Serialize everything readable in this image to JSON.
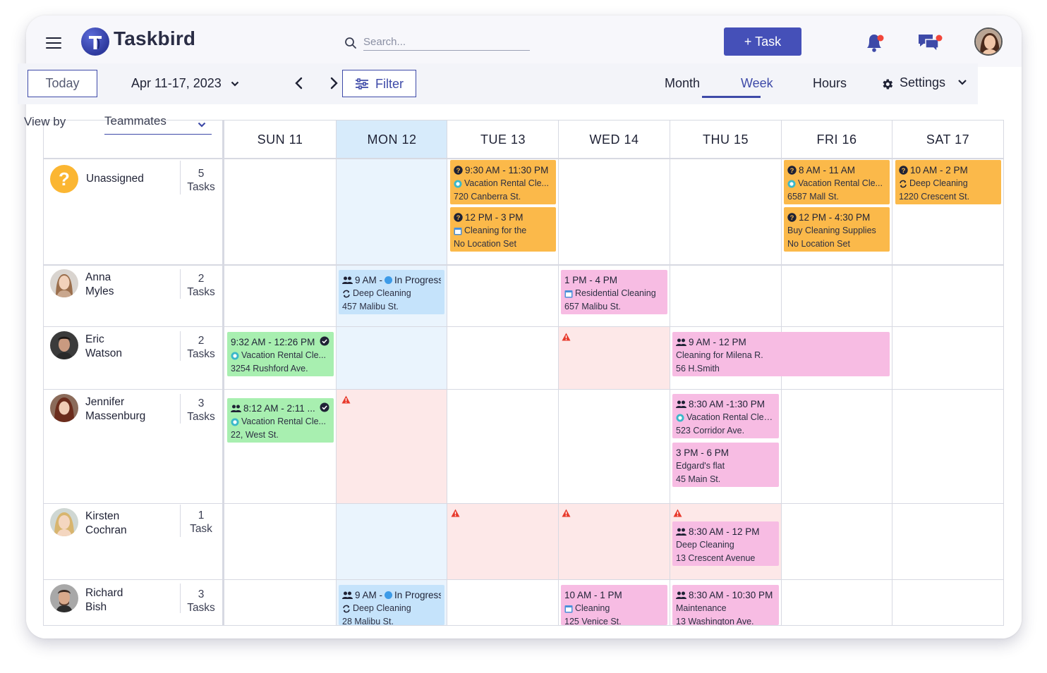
{
  "app": {
    "name": "Taskbird"
  },
  "header": {
    "search_placeholder": "Search...",
    "add_task_label": "+ Task"
  },
  "toolbar": {
    "today_label": "Today",
    "date_range": "Apr 11-17, 2023",
    "filter_label": "Filter",
    "views": [
      "Month",
      "Week",
      "Hours"
    ],
    "active_view": "Week",
    "settings_label": "Settings"
  },
  "grid": {
    "view_by_label": "View by",
    "view_by_value": "Teammates",
    "days": [
      "SUN 11",
      "MON 12",
      "TUE 13",
      "WED 14",
      "THU 15",
      "FRI 16",
      "SAT 17"
    ],
    "today_index": 1
  },
  "rows": [
    {
      "first": "Unassigned",
      "last": "",
      "count": "5",
      "count_label": "Tasks"
    },
    {
      "first": "Anna",
      "last": "Myles",
      "count": "2",
      "count_label": "Tasks"
    },
    {
      "first": "Eric",
      "last": "Watson",
      "count": "2",
      "count_label": "Tasks"
    },
    {
      "first": "Jennifer",
      "last": "Massenburg",
      "count": "3",
      "count_label": "Tasks"
    },
    {
      "first": "Kirsten",
      "last": "Cochran",
      "count": "1",
      "count_label": "Task"
    },
    {
      "first": "Richard",
      "last": "Bish",
      "count": "3",
      "count_label": "Tasks"
    }
  ],
  "tasks": {
    "t1": {
      "time": "9:30 AM - 11:30 PM",
      "title": "Vacation Rental Cle...",
      "location": "720 Canberra St."
    },
    "t2": {
      "time": "12 PM - 3 PM",
      "title": "Cleaning for the",
      "location": "No Location Set"
    },
    "t3": {
      "time": "8 AM - 11 AM",
      "title": "Vacation Rental Cle...",
      "location": "6587 Mall St."
    },
    "t4": {
      "time": "12 PM - 4:30 PM",
      "title": "Buy Cleaning Supplies",
      "location": "No Location Set"
    },
    "t5": {
      "time": "10 AM - 2 PM",
      "title": "Deep Cleaning",
      "location": "1220 Crescent St."
    },
    "t6": {
      "time": "9 AM -",
      "status": "In Progress",
      "title": "Deep Cleaning",
      "location": "457 Malibu St."
    },
    "t7": {
      "time": "1 PM - 4 PM",
      "title": "Residential Cleaning",
      "location": "657 Malibu St."
    },
    "t8": {
      "time": "9:32 AM - 12:26 PM",
      "title": "Vacation Rental Cle...",
      "location": "3254 Rushford Ave."
    },
    "t9": {
      "time": "9 AM - 12 PM",
      "title": "Cleaning for Milena R.",
      "location": "56 H.Smith"
    },
    "t10": {
      "time": "8:12 AM - 2:11 ...",
      "title": "Vacation Rental Cle...",
      "location": "22, West St."
    },
    "t11": {
      "time": "8:30 AM -1:30 PM",
      "title": "Vacation Rental Clea...",
      "location": "523 Corridor Ave."
    },
    "t12": {
      "time": "3 PM - 6 PM",
      "title": "Edgard's flat",
      "location": "45 Main St."
    },
    "t13": {
      "time": "8:30 AM - 12 PM",
      "title": "Deep Cleaning",
      "location": "13 Crescent Avenue"
    },
    "t14": {
      "time": "9 AM -",
      "status": "In Progress",
      "title": "Deep Cleaning",
      "location": "28 Malibu St."
    },
    "t15": {
      "time": "10 AM - 1 PM",
      "title": "Cleaning",
      "location": "125 Venice St."
    },
    "t16": {
      "time": "8:30 AM - 10:30 PM",
      "title": "Maintenance",
      "location": "13 Washington Ave."
    }
  },
  "colors": {
    "accent": "#3e4aa8",
    "unassigned": "#fbb94a",
    "in_progress": "#c5e3fb",
    "scheduled": "#f7bce3",
    "completed": "#a8efb0",
    "conflict": "#fde8e8"
  }
}
